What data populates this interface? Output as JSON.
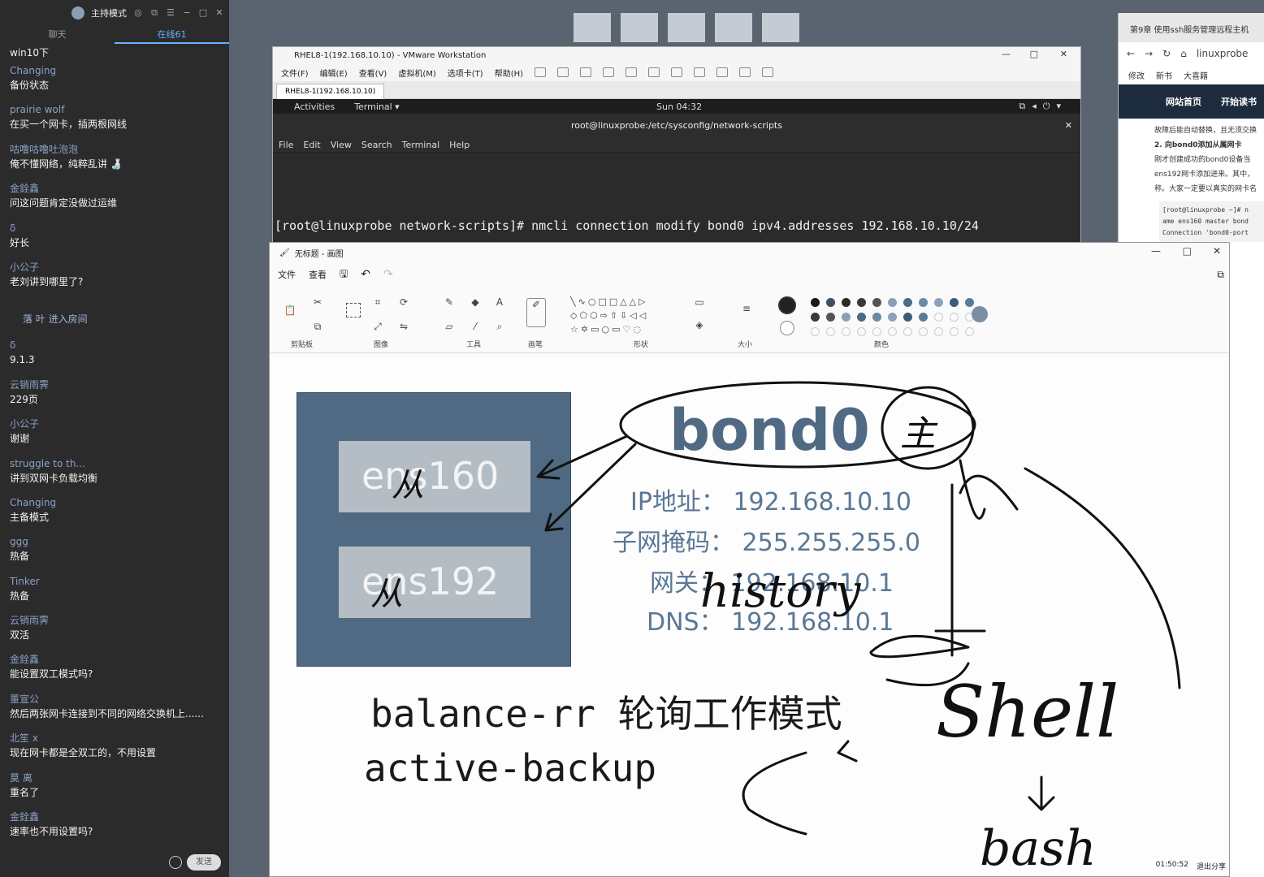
{
  "chat": {
    "mode_label": "主持模式",
    "tabs": [
      "聊天",
      "在线61"
    ],
    "messages": [
      {
        "author": "Changing",
        "text": "win10下"
      },
      {
        "author": "Changing",
        "text": "备份状态"
      },
      {
        "author": "prairie wolf",
        "text": "在买一个网卡，插两根网线"
      },
      {
        "author": "咕噜咕噜吐泡泡",
        "text": "俺不懂网络，纯粹乱讲 🍶"
      },
      {
        "author": "金銓鑫",
        "text": "问这问题肯定没做过运维"
      },
      {
        "author": "δ",
        "text": "好长"
      },
      {
        "author": "小公子",
        "text": "老刘讲到哪里了?"
      },
      {
        "author": "",
        "text": "落  叶 进入房间",
        "system": true
      },
      {
        "author": "δ",
        "text": "9.1.3"
      },
      {
        "author": "云销雨霁",
        "text": "229页"
      },
      {
        "author": "小公子",
        "text": "谢谢"
      },
      {
        "author": "struggle to th...",
        "text": "讲到双网卡负载均衡"
      },
      {
        "author": "Changing",
        "text": "主备模式"
      },
      {
        "author": "ggg",
        "text": "热备"
      },
      {
        "author": "Tinker",
        "text": "热备"
      },
      {
        "author": "云销雨霁",
        "text": "双活"
      },
      {
        "author": "金銓鑫",
        "text": "能设置双工模式吗?"
      },
      {
        "author": "董宣公",
        "text": "然后两张网卡连接到不同的网络交换机上......"
      },
      {
        "author": "北笙 ⅹ",
        "text": "现在网卡都是全双工的，不用设置"
      },
      {
        "author": "莫 离",
        "text": "重名了"
      },
      {
        "author": "金銓鑫",
        "text": "速率也不用设置吗?"
      }
    ],
    "send_label": "发送"
  },
  "vmware": {
    "title": "RHEL8-1(192.168.10.10) - VMware Workstation",
    "menu": [
      "文件(F)",
      "编辑(E)",
      "查看(V)",
      "虚拟机(M)",
      "选项卡(T)",
      "帮助(H)"
    ],
    "tab": "RHEL8-1(192.168.10.10)",
    "gnome": {
      "activities": "Activities",
      "app": "Terminal ▾",
      "clock": "Sun 04:32"
    },
    "terminal_title": "root@linuxprobe:/etc/sysconfig/network-scripts",
    "terminal_menu": [
      "File",
      "Edit",
      "View",
      "Search",
      "Terminal",
      "Help"
    ],
    "command_line": "[root@linuxprobe network-scripts]# nmcli connection modify bond0 ipv4.addresses 192.168.10.10/24"
  },
  "paint": {
    "title": "无标题 - 画图",
    "menu": [
      "文件",
      "查看"
    ],
    "groups": [
      "剪贴板",
      "图像",
      "工具",
      "画笔",
      "形状",
      "大小",
      "颜色"
    ],
    "status_time": "01:50:52",
    "status_exit": "退出分享",
    "colors": [
      "#1a1a1a",
      "#3d4f66",
      "#2b2b2b",
      "#3a3a3a",
      "#555555",
      "#8aa0b8",
      "#4a6a8a",
      "#6a8aa6",
      "#8aa3bd",
      "#3e5a7a",
      "#5b7a96"
    ],
    "diagram": {
      "nic1": "ens160",
      "nic2": "ens192",
      "bond": "bond0",
      "bond_mark": "主",
      "ip": "IP地址： 192.168.10.10",
      "mask": "子网掩码： 255.255.255.0",
      "gateway": "网关： 192.168.10.1",
      "dns": "DNS： 192.168.10.1",
      "mode1": "balance-rr 轮询工作模式",
      "mode2": "active-backup",
      "handwriting": [
        "从",
        "从",
        "history",
        "Shell",
        "bash"
      ]
    }
  },
  "browser": {
    "tab": "第9章 使用ssh服务管理远程主机",
    "url": "linuxprobe",
    "bookmarks": [
      "修改",
      "新书",
      "大喜籍"
    ],
    "nav": [
      "网站首页",
      "开始读书"
    ],
    "article_lines": [
      "故障后能自动替换，且无须交换",
      "2. 向bond0添加从属网卡",
      "刚才创建成功的bond0设备当",
      "ens192网卡添加进来。其中，",
      "称。大家一定要以真实的网卡名"
    ],
    "code_lines": [
      "[root@linuxprobe ~]# n",
      "ame ens160 master bond",
      "Connection 'bond0-port"
    ]
  }
}
